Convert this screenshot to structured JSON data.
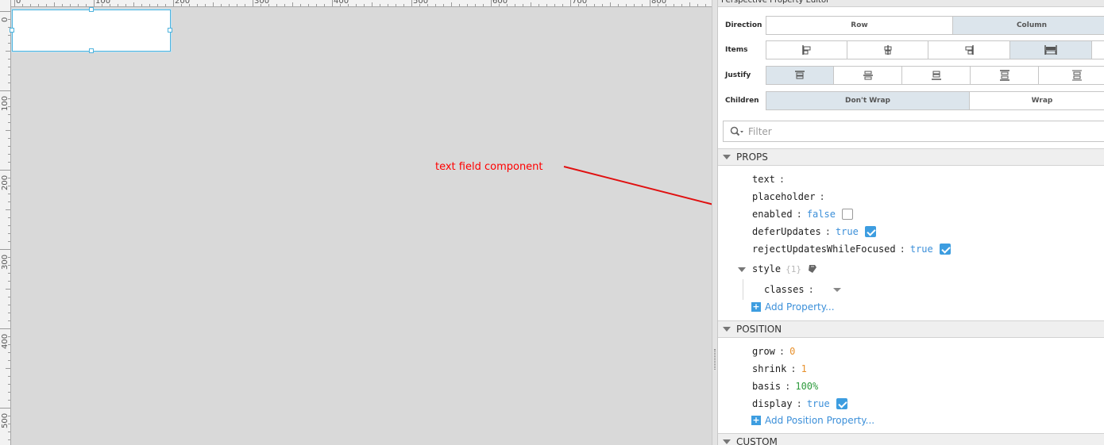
{
  "panel": {
    "title": "Perspective Property Editor"
  },
  "ruler": {
    "top_labels": [
      "0",
      "100",
      "200",
      "300",
      "400",
      "500",
      "600",
      "700",
      "800"
    ],
    "left_labels": [
      "0",
      "100",
      "200",
      "300",
      "400",
      "500"
    ]
  },
  "annotation": {
    "text": "text field component",
    "color": "#ff0000"
  },
  "layout": {
    "direction": {
      "label": "Direction",
      "options": [
        "Row",
        "Column"
      ],
      "selected": "Column"
    },
    "items": {
      "label": "Items",
      "selected_index": 3
    },
    "justify": {
      "label": "Justify",
      "selected_index": 0
    },
    "children": {
      "label": "Children",
      "options": [
        "Don't Wrap",
        "Wrap"
      ],
      "selected": "Don't Wrap"
    }
  },
  "filter": {
    "placeholder": "Filter"
  },
  "props": {
    "title": "PROPS",
    "text": {
      "key": "text",
      "value": ""
    },
    "placeholder": {
      "key": "placeholder",
      "value": ""
    },
    "enabled": {
      "key": "enabled",
      "value": "false",
      "checked": false
    },
    "deferUpdates": {
      "key": "deferUpdates",
      "value": "true",
      "checked": true
    },
    "rejectUpdatesWhileFocused": {
      "key": "rejectUpdatesWhileFocused",
      "value": "true",
      "checked": true
    },
    "style": {
      "key": "style",
      "count": "{1}"
    },
    "classes": {
      "key": "classes"
    },
    "add_label": "Add Property..."
  },
  "position": {
    "title": "POSITION",
    "grow": {
      "key": "grow",
      "value": "0"
    },
    "shrink": {
      "key": "shrink",
      "value": "1"
    },
    "basis": {
      "key": "basis",
      "value": "100%"
    },
    "display": {
      "key": "display",
      "value": "true",
      "checked": true
    },
    "add_label": "Add Position Property..."
  },
  "custom": {
    "title": "CUSTOM"
  },
  "colors": {
    "accent": "#3d9de0",
    "selection": "#4fb3dd",
    "canvas": "#d9d9d9"
  }
}
